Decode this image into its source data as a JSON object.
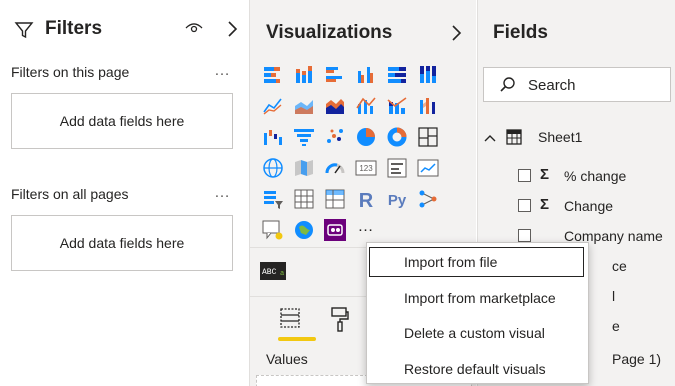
{
  "filters": {
    "title": "Filters",
    "on_page_label": "Filters on this page",
    "on_page_well": "Add data fields here",
    "all_pages_label": "Filters on all pages",
    "all_pages_well": "Add data fields here",
    "more": "…"
  },
  "viz": {
    "title": "Visualizations",
    "more_visuals": "…",
    "values_label": "Values"
  },
  "fields": {
    "title": "Fields",
    "search_placeholder": "Search",
    "table_name": "Sheet1",
    "items": [
      {
        "label": "% change",
        "sigma": "Σ"
      },
      {
        "label": "Change",
        "sigma": "Σ"
      },
      {
        "label": "Company name",
        "sigma": ""
      },
      {
        "label": "ce",
        "sigma": ""
      },
      {
        "label": "l",
        "sigma": ""
      },
      {
        "label": "e",
        "sigma": ""
      },
      {
        "label": "Page 1)",
        "sigma": ""
      }
    ]
  },
  "context_menu": {
    "items": [
      "Import from file",
      "Import from marketplace",
      "Delete a custom visual",
      "Restore default visuals"
    ]
  },
  "icons": {
    "r_visual": "R",
    "py_visual": "Py"
  },
  "colors": {
    "accent": "#f2c811",
    "viz_blue": "#118dff",
    "viz_orange": "#e66c37",
    "custom_visual": "#6b007b"
  }
}
